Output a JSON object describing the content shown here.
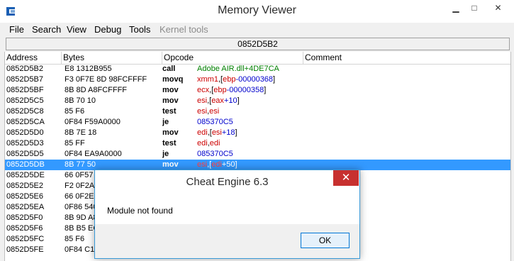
{
  "window": {
    "title": "Memory Viewer",
    "min_glyph": "▁",
    "max_glyph": "□",
    "close_glyph": "✕"
  },
  "menubar": {
    "items": [
      {
        "label": "File",
        "enabled": true
      },
      {
        "label": "Search",
        "enabled": true
      },
      {
        "label": "View",
        "enabled": true
      },
      {
        "label": "Debug",
        "enabled": true
      },
      {
        "label": "Tools",
        "enabled": true
      },
      {
        "label": "Kernel tools",
        "enabled": false
      }
    ]
  },
  "address_bar": {
    "value": "0852D5B2"
  },
  "disassembler": {
    "columns": [
      "Address",
      "Bytes",
      "Opcode",
      "Comment"
    ],
    "rows": [
      {
        "address": "0852D5B2",
        "bytes": "E8 1312B955",
        "opcode": "call",
        "args": [
          {
            "t": "Adobe AIR.dll+4DE7CA",
            "k": "sym"
          }
        ]
      },
      {
        "address": "0852D5B7",
        "bytes": "F3 0F7E 8D 98FCFFFF",
        "opcode": "movq",
        "args": [
          {
            "t": "xmm1",
            "k": "reg"
          },
          {
            "t": ",[",
            "k": "plain"
          },
          {
            "t": "ebp",
            "k": "reg"
          },
          {
            "t": "-00000368",
            "k": "num"
          },
          {
            "t": "]",
            "k": "plain"
          }
        ]
      },
      {
        "address": "0852D5BF",
        "bytes": "8B 8D A8FCFFFF",
        "opcode": "mov",
        "args": [
          {
            "t": "ecx",
            "k": "reg"
          },
          {
            "t": ",[",
            "k": "plain"
          },
          {
            "t": "ebp",
            "k": "reg"
          },
          {
            "t": "-00000358",
            "k": "num"
          },
          {
            "t": "]",
            "k": "plain"
          }
        ]
      },
      {
        "address": "0852D5C5",
        "bytes": "8B 70 10",
        "opcode": "mov",
        "args": [
          {
            "t": "esi",
            "k": "reg"
          },
          {
            "t": ",[",
            "k": "plain"
          },
          {
            "t": "eax",
            "k": "reg"
          },
          {
            "t": "+10",
            "k": "num"
          },
          {
            "t": "]",
            "k": "plain"
          }
        ]
      },
      {
        "address": "0852D5C8",
        "bytes": "85 F6",
        "opcode": "test",
        "args": [
          {
            "t": "esi",
            "k": "reg"
          },
          {
            "t": ",",
            "k": "plain"
          },
          {
            "t": "esi",
            "k": "reg"
          }
        ]
      },
      {
        "address": "0852D5CA",
        "bytes": "0F84 F59A0000",
        "opcode": "je",
        "args": [
          {
            "t": "085370C5",
            "k": "num"
          }
        ]
      },
      {
        "address": "0852D5D0",
        "bytes": "8B 7E 18",
        "opcode": "mov",
        "args": [
          {
            "t": "edi",
            "k": "reg"
          },
          {
            "t": ",[",
            "k": "plain"
          },
          {
            "t": "esi",
            "k": "reg"
          },
          {
            "t": "+18",
            "k": "num"
          },
          {
            "t": "]",
            "k": "plain"
          }
        ]
      },
      {
        "address": "0852D5D3",
        "bytes": "85 FF",
        "opcode": "test",
        "args": [
          {
            "t": "edi",
            "k": "reg"
          },
          {
            "t": ",",
            "k": "plain"
          },
          {
            "t": "edi",
            "k": "reg"
          }
        ]
      },
      {
        "address": "0852D5D5",
        "bytes": "0F84 EA9A0000",
        "opcode": "je",
        "args": [
          {
            "t": "085370C5",
            "k": "num"
          }
        ]
      },
      {
        "address": "0852D5DB",
        "bytes": "8B 77 50",
        "opcode": "mov",
        "selected": true,
        "args": [
          {
            "t": "esi",
            "k": "reg"
          },
          {
            "t": ",[",
            "k": "plain"
          },
          {
            "t": "edi",
            "k": "reg"
          },
          {
            "t": "+50",
            "k": "num"
          },
          {
            "t": "]",
            "k": "plain"
          }
        ]
      },
      {
        "address": "0852D5DE",
        "bytes": "66 0F57",
        "opcode": "",
        "args": []
      },
      {
        "address": "0852D5E2",
        "bytes": "F2 0F2A",
        "opcode": "",
        "args": []
      },
      {
        "address": "0852D5E6",
        "bytes": "66 0F2E",
        "opcode": "",
        "args": []
      },
      {
        "address": "0852D5EA",
        "bytes": "0F86 540",
        "opcode": "",
        "args": []
      },
      {
        "address": "0852D5F0",
        "bytes": "8B 9D A8",
        "opcode": "",
        "args": []
      },
      {
        "address": "0852D5F6",
        "bytes": "8B B5 EC",
        "opcode": "",
        "args": []
      },
      {
        "address": "0852D5FC",
        "bytes": "85 F6",
        "opcode": "",
        "args": []
      },
      {
        "address": "0852D5FE",
        "bytes": "0F84 C1S",
        "opcode": "",
        "args": []
      }
    ]
  },
  "dialog": {
    "title": "Cheat Engine 6.3",
    "message": "Module not found",
    "ok_label": "OK",
    "close_glyph": "✕"
  },
  "colors": {
    "selection": "#3399ff",
    "register": "#cc0000",
    "number": "#0000cc",
    "symbol": "#008000",
    "dialog_close": "#c7302f",
    "dialog_border": "#3899d7"
  }
}
